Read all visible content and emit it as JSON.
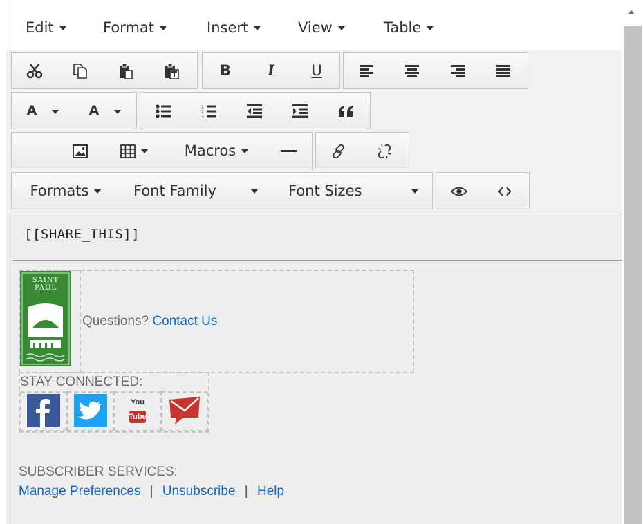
{
  "menubar": {
    "items": [
      {
        "label": "Edit"
      },
      {
        "label": "Format"
      },
      {
        "label": "Insert"
      },
      {
        "label": "View"
      },
      {
        "label": "Table"
      }
    ]
  },
  "toolbar": {
    "text_color_letter": "A",
    "bg_color_letter": "A",
    "bold_letter": "B",
    "italic_letter": "I",
    "underline_letter": "U",
    "macros_label": "Macros",
    "formats_label": "Formats",
    "font_family_label": "Font Family",
    "font_sizes_label": "Font Sizes"
  },
  "content": {
    "share_token": "[[SHARE_THIS]]",
    "logo_text_line1": "SAINT",
    "logo_text_line2": "PAUL",
    "questions_text": "Questions?",
    "contact_link": "Contact Us",
    "stay_connected": "STAY CONNECTED:",
    "youtube_text": "You",
    "youtube_text2": "Tube",
    "subscriber_services": "SUBSCRIBER SERVICES:",
    "links": {
      "manage": "Manage Preferences",
      "sep": "|",
      "unsubscribe": "Unsubscribe",
      "help": "Help"
    }
  },
  "colors": {
    "link": "#1568c4",
    "logo_green": "#3a8a35",
    "facebook": "#3b5998",
    "twitter": "#1da1f2",
    "youtube_red": "#c4302b"
  }
}
